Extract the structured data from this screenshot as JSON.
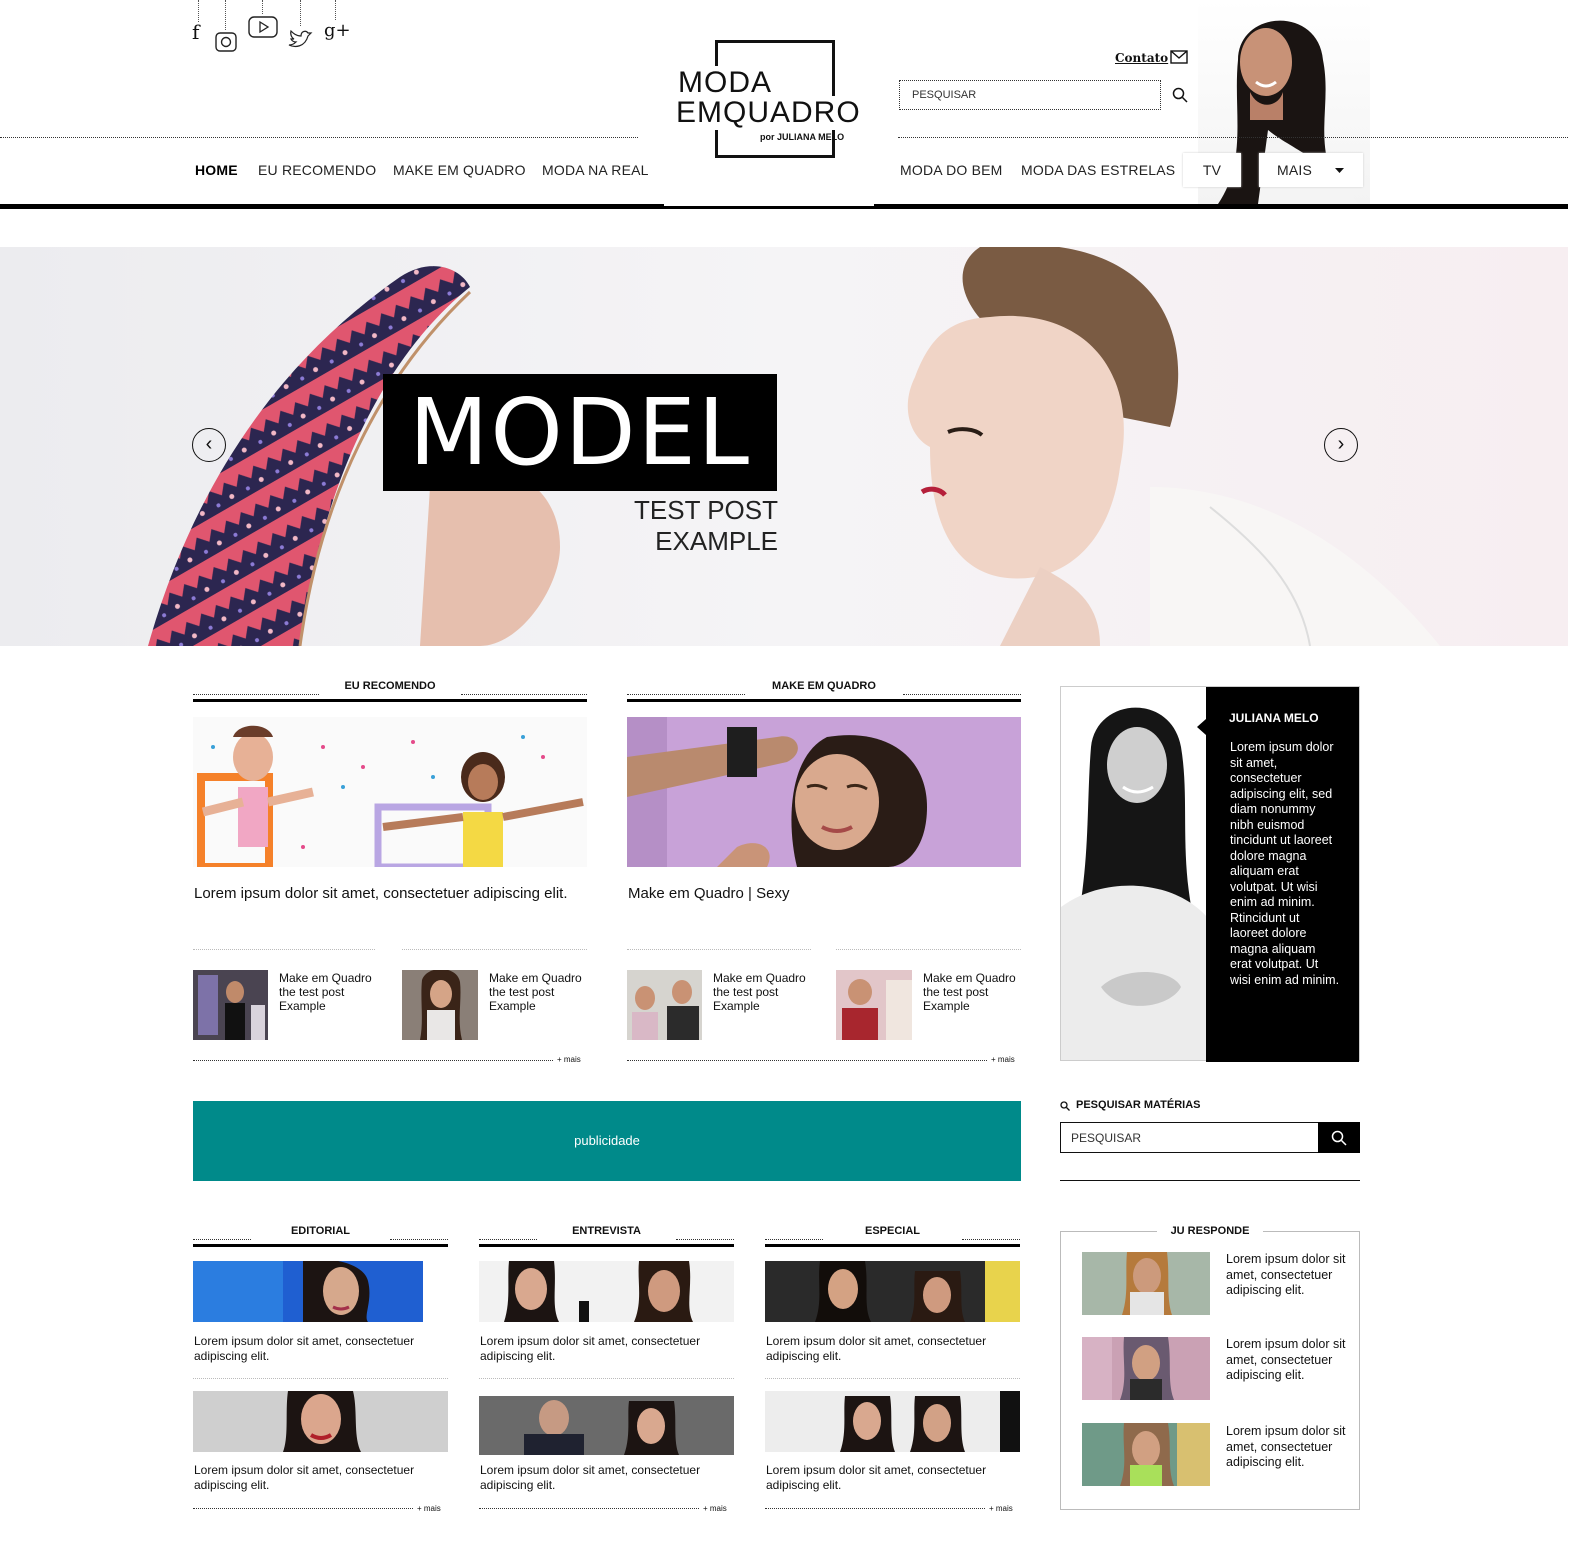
{
  "header": {
    "logo": {
      "line1": "MODA",
      "line2": "EMQUADRO",
      "byline": "por JULIANA MELO"
    },
    "contact_label": "Contato",
    "search_placeholder": "PESQUISAR",
    "social_icons": [
      "facebook-icon",
      "instagram-icon",
      "youtube-icon",
      "twitter-icon",
      "google-plus-icon"
    ]
  },
  "nav": {
    "left": [
      "HOME",
      "EU RECOMENDO",
      "MAKE EM QUADRO",
      "MODA NA REAL"
    ],
    "right": [
      "MODA DO BEM",
      "MODA DAS ESTRELAS"
    ],
    "tv": "TV",
    "more": "MAIS"
  },
  "hero": {
    "title": "MODEL",
    "subtitle": "TEST POST EXAMPLE"
  },
  "eu_recomendo": {
    "heading": "EU RECOMENDO",
    "caption": "Lorem ipsum dolor sit amet, consectetuer adipiscing elit.",
    "items": [
      {
        "l1": "Make em Quadro",
        "l2": "the test post",
        "l3": "Example"
      },
      {
        "l1": "Make em Quadro",
        "l2": "the test post",
        "l3": "Example"
      }
    ],
    "more": "+ mais"
  },
  "make_em_quadro": {
    "heading": "MAKE EM QUADRO",
    "caption": "Make em Quadro | Sexy",
    "items": [
      {
        "l1": "Make em Quadro",
        "l2": "the test post",
        "l3": "Example"
      },
      {
        "l1": "Make em Quadro",
        "l2": "the test post",
        "l3": "Example"
      }
    ],
    "more": "+ mais"
  },
  "publicidade": "publicidade",
  "bio": {
    "name": "JULIANA MELO",
    "text": "Lorem ipsum dolor sit amet, consectetuer adipiscing elit, sed diam nonummy nibh euismod tincidunt ut laoreet dolore magna aliquam erat volutpat. Ut wisi enim ad minim. Rtincidunt ut laoreet dolore magna aliquam erat volutpat. Ut wisi enim ad minim."
  },
  "side_search": {
    "label": "PESQUISAR MATÉRIAS",
    "placeholder": "PESQUISAR"
  },
  "editorial": {
    "heading": "EDITORIAL",
    "captions": [
      "Lorem ipsum dolor sit amet, consectetuer adipiscing elit.",
      "Lorem ipsum dolor sit amet, consectetuer adipiscing elit."
    ],
    "more": "+ mais"
  },
  "entrevista": {
    "heading": "ENTREVISTA",
    "captions": [
      "Lorem ipsum dolor sit amet, consectetuer adipiscing elit.",
      "Lorem ipsum dolor sit amet, consectetuer adipiscing elit."
    ],
    "more": "+ mais"
  },
  "especial": {
    "heading": "ESPECIAL",
    "captions": [
      "Lorem ipsum dolor sit amet, consectetuer adipiscing elit.",
      "Lorem ipsum dolor sit amet, consectetuer adipiscing elit."
    ],
    "more": "+ mais"
  },
  "ju_responde": {
    "heading": "JU RESPONDE",
    "items": [
      "Lorem ipsum dolor sit amet, consectetuer adipiscing elit.",
      "Lorem ipsum dolor sit amet, consectetuer adipiscing elit.",
      "Lorem ipsum dolor sit amet, consectetuer adipiscing elit."
    ]
  },
  "colors": {
    "accent": "#008a8a",
    "black": "#000000"
  }
}
